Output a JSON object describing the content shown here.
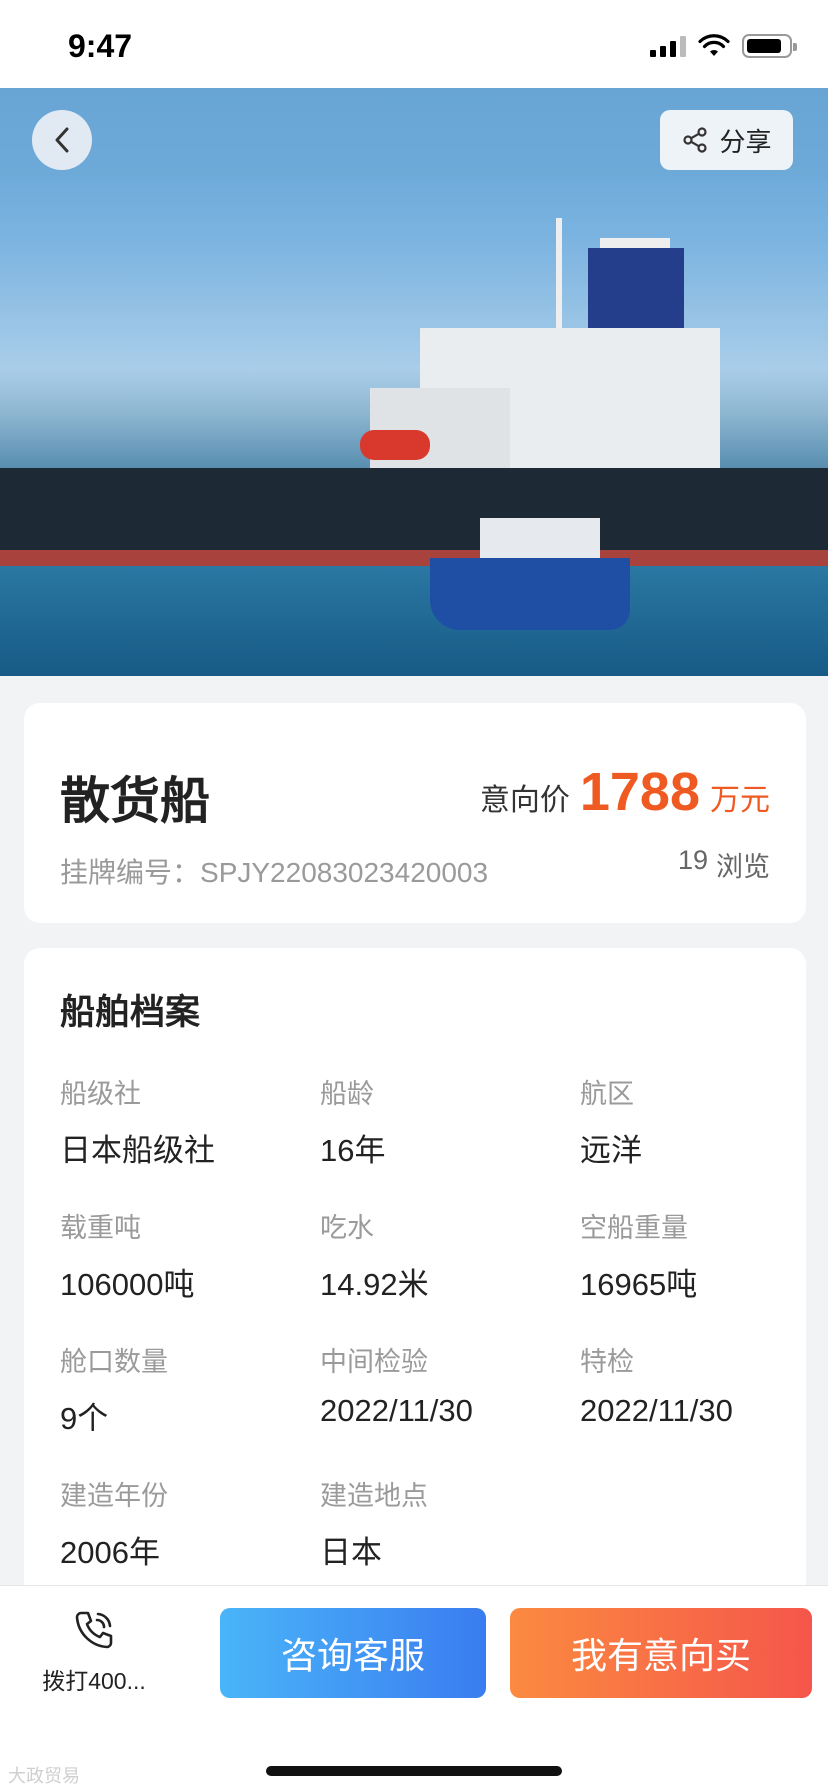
{
  "status_bar": {
    "time": "9:47"
  },
  "header": {
    "share_label": "分享"
  },
  "hero": {
    "image_icon": "ship-photo"
  },
  "listing": {
    "name": "散货船",
    "price_label": "意向价",
    "price": "1788",
    "price_unit": "万元",
    "listing_no_label": "挂牌编号：",
    "listing_no": "SPJY22083023420003",
    "views_count": "19",
    "views_label": "浏览"
  },
  "archive": {
    "title": "船舶档案",
    "fields": [
      {
        "label": "船级社",
        "value": "日本船级社"
      },
      {
        "label": "船龄",
        "value": "16年"
      },
      {
        "label": "航区",
        "value": "远洋"
      },
      {
        "label": "载重吨",
        "value": "106000吨"
      },
      {
        "label": "吃水",
        "value": "14.92米"
      },
      {
        "label": "空船重量",
        "value": "16965吨"
      },
      {
        "label": "舱口数量",
        "value": "9个"
      },
      {
        "label": "中间检验",
        "value": "2022/11/30"
      },
      {
        "label": "特检",
        "value": "2022/11/30"
      },
      {
        "label": "建造年份",
        "value": "2006年"
      },
      {
        "label": "建造地点",
        "value": "日本"
      }
    ]
  },
  "bottom_bar": {
    "call_label": "拨打400...",
    "consult_label": "咨询客服",
    "intent_label": "我有意向买"
  },
  "watermark": "大政贸易",
  "colors": {
    "price": "#ee5a22",
    "consult": "#3a7cf0",
    "intent": "#f5564b"
  }
}
